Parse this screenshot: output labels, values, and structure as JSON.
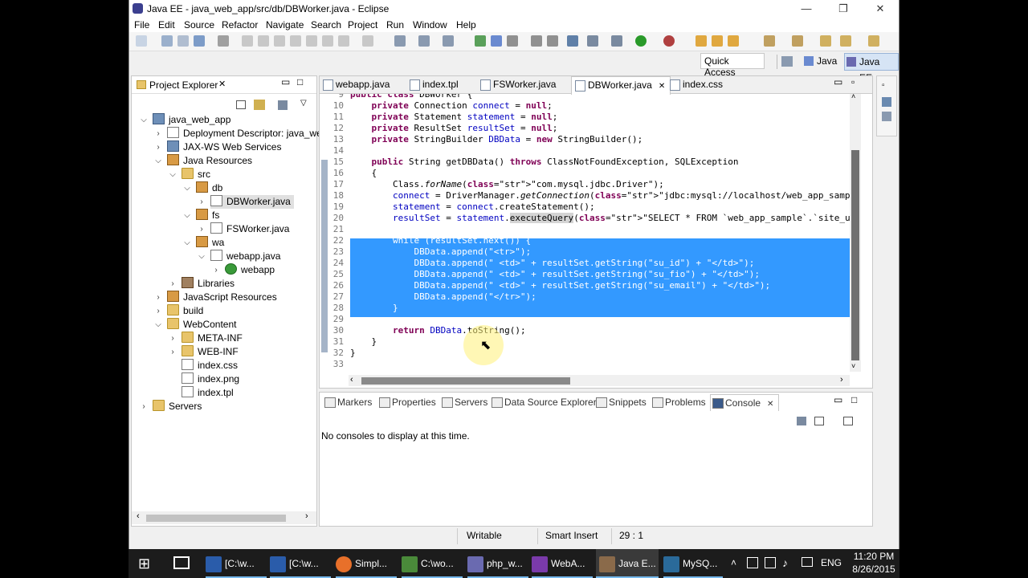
{
  "window": {
    "title": "Java EE - java_web_app/src/db/DBWorker.java - Eclipse",
    "minimize": "—",
    "maximize": "❐",
    "close": "✕"
  },
  "menu": [
    "File",
    "Edit",
    "Source",
    "Refactor",
    "Navigate",
    "Search",
    "Project",
    "Run",
    "Window",
    "Help"
  ],
  "quick_access": {
    "placeholder": "Quick Access"
  },
  "perspectives": [
    "Java",
    "Java EE"
  ],
  "explorer": {
    "title": "Project Explorer",
    "items": [
      {
        "label": "java_web_app",
        "icon": "project-icon",
        "expanded": true
      },
      {
        "label": "Deployment Descriptor: java_web",
        "icon": "descriptor-icon",
        "expanded": false
      },
      {
        "label": "JAX-WS Web Services",
        "icon": "webservice-icon",
        "expanded": false
      },
      {
        "label": "Java Resources",
        "icon": "java-resources-icon",
        "expanded": true
      },
      {
        "label": "src",
        "icon": "source-folder-icon",
        "expanded": true
      },
      {
        "label": "db",
        "icon": "package-icon",
        "expanded": true
      },
      {
        "label": "DBWorker.java",
        "icon": "java-file-icon",
        "expanded": false,
        "selected": true
      },
      {
        "label": "fs",
        "icon": "package-icon",
        "expanded": true
      },
      {
        "label": "FSWorker.java",
        "icon": "java-file-icon",
        "expanded": false
      },
      {
        "label": "wa",
        "icon": "package-icon",
        "expanded": true
      },
      {
        "label": "webapp.java",
        "icon": "java-file-icon",
        "expanded": true
      },
      {
        "label": "webapp",
        "icon": "class-icon",
        "expanded": false
      },
      {
        "label": "Libraries",
        "icon": "library-icon",
        "expanded": false
      },
      {
        "label": "JavaScript Resources",
        "icon": "js-resources-icon",
        "expanded": false
      },
      {
        "label": "build",
        "icon": "folder-icon",
        "expanded": false
      },
      {
        "label": "WebContent",
        "icon": "folder-icon",
        "expanded": true
      },
      {
        "label": "META-INF",
        "icon": "folder-icon",
        "expanded": false
      },
      {
        "label": "WEB-INF",
        "icon": "folder-icon",
        "expanded": false
      },
      {
        "label": "index.css",
        "icon": "file-icon"
      },
      {
        "label": "index.png",
        "icon": "file-icon"
      },
      {
        "label": "index.tpl",
        "icon": "file-icon"
      },
      {
        "label": "Servers",
        "icon": "folder-icon",
        "expanded": false
      }
    ]
  },
  "editor_tabs": [
    "webapp.java",
    "index.tpl",
    "FSWorker.java",
    "DBWorker.java",
    "index.css"
  ],
  "active_tab": "DBWorker.java",
  "code": {
    "line_numbers": [
      "9",
      "10",
      "11",
      "12",
      "13",
      "14",
      "15",
      "16",
      "17",
      "18",
      "19",
      "20",
      "21",
      "22",
      "23",
      "24",
      "25",
      "26",
      "27",
      "28",
      "29",
      "30",
      "31",
      "32",
      "33"
    ],
    "lines": [
      "public class DBWorker {",
      "    private Connection connect = null;",
      "    private Statement statement = null;",
      "    private ResultSet resultSet = null;",
      "    private StringBuilder DBData = new StringBuilder();",
      "",
      "    public String getDBData() throws ClassNotFoundException, SQLException",
      "    {",
      "        Class.forName(\"com.mysql.jdbc.Driver\");",
      "        connect = DriverManager.getConnection(\"jdbc:mysql://localhost/web_app_sample?user=root&",
      "        statement = connect.createStatement();",
      "        resultSet = statement.executeQuery(\"SELECT * FROM `web_app_sample`.`site_users` ORDER B",
      "",
      "        while (resultSet.next()) {",
      "            DBData.append(\"<tr>\");",
      "            DBData.append(\" <td>\" + resultSet.getString(\"su_id\") + \"</td>\");",
      "            DBData.append(\" <td>\" + resultSet.getString(\"su_fio\") + \"</td>\");",
      "            DBData.append(\" <td>\" + resultSet.getString(\"su_email\") + \"</td>\");",
      "            DBData.append(\"</tr>\");",
      "        }",
      "",
      "        return DBData.toString();",
      "    }",
      "}",
      ""
    ]
  },
  "bottom_tabs": [
    "Markers",
    "Properties",
    "Servers",
    "Data Source Explorer",
    "Snippets",
    "Problems",
    "Console"
  ],
  "active_bottom_tab": "Console",
  "console_message": "No consoles to display at this time.",
  "status": {
    "writable": "Writable",
    "insert_mode": "Smart Insert",
    "position": "29 : 1"
  },
  "taskbar": {
    "items": [
      "[C:\\w...",
      "[C:\\w...",
      "Simpl...",
      "C:\\wo...",
      "php_w...",
      "WebA...",
      "Java E...",
      "MySQ..."
    ],
    "lang": "ENG",
    "time": "11:20 PM",
    "date": "8/26/2015"
  }
}
